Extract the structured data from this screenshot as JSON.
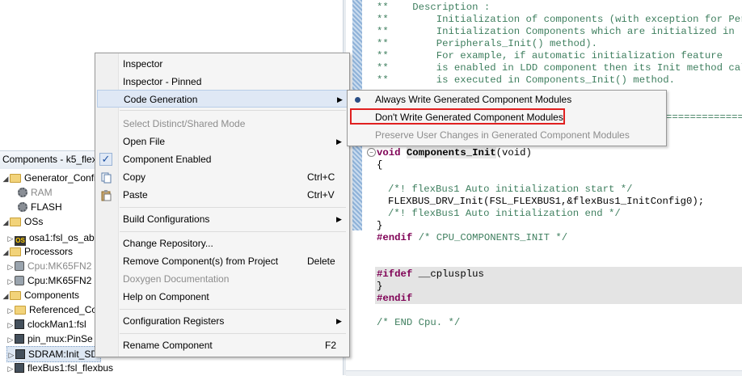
{
  "tree": {
    "header": "Components - k5_flex",
    "rows": [
      {
        "label": "Generator_Config",
        "icon": "folder-icon"
      },
      {
        "label": "RAM",
        "icon": "gear-icon"
      },
      {
        "label": "FLASH",
        "icon": "gear-icon"
      },
      {
        "label": "OSs",
        "icon": "folder-icon"
      },
      {
        "label": "osa1:fsl_os_ab",
        "icon": "os-component-icon"
      },
      {
        "label": "Processors",
        "icon": "folder-icon"
      },
      {
        "label": "Cpu:MK65FN2",
        "icon": "cpu-icon"
      },
      {
        "label": "Cpu:MK65FN2",
        "icon": "cpu-icon"
      },
      {
        "label": "Components",
        "icon": "folder-icon"
      },
      {
        "label": "Referenced_Co",
        "icon": "folder-icon"
      },
      {
        "label": "clockMan1:fsl",
        "icon": "component-icon"
      },
      {
        "label": "pin_mux:PinSe",
        "icon": "component-icon"
      },
      {
        "label": "SDRAM:Init_SD",
        "icon": "component-icon"
      },
      {
        "label": "flexBus1:fsl_flexbus",
        "icon": "component-icon"
      }
    ]
  },
  "editor": {
    "lines": {
      "l1": "**    Description :",
      "l2": "**        Initialization of components (with exception for Perip",
      "l3": "**        Initialization Components which are initialized in",
      "l4": "**        Peripherals_Init() method).",
      "l5": "**        For example, if automatic initialization feature",
      "l6": "**        is enabled in LDD component then its Init method call",
      "l7": "**        is executed in Components_Init() method.",
      "sepline": "=================",
      "func_kw": "void",
      "func_name": "Components_Init",
      "func_args": "(void)",
      "brace_open": "{",
      "c_start": "/*! flexBus1 Auto initialization start */",
      "call": "FLEXBUS_DRV_Init(FSL_FLEXBUS1,&flexBus1_InitConfig0);",
      "c_end": "/*! flexBus1 Auto initialization end */",
      "brace_close": "}",
      "endif1_kw": "#endif",
      "endif1_cmt": "/* CPU_COMPONENTS_INIT */",
      "ifdef_kw": "#ifdef",
      "ifdef_rest": " __cplusplus",
      "brace_close2": "}",
      "endif2_kw": "#endif",
      "end_cmt": "/* END Cpu. */"
    }
  },
  "context_menu": {
    "items": [
      {
        "label": "Inspector"
      },
      {
        "label": "Inspector - Pinned"
      },
      {
        "label": "Code Generation",
        "submenu": true,
        "highlighted": true
      },
      {
        "label": "Select Distinct/Shared Mode",
        "disabled": true
      },
      {
        "label": "Open File",
        "submenu": true
      },
      {
        "label": "Component Enabled",
        "checked": true
      },
      {
        "label": "Copy",
        "shortcut": "Ctrl+C"
      },
      {
        "label": "Paste",
        "shortcut": "Ctrl+V"
      },
      {
        "label": "Build Configurations",
        "submenu": true
      },
      {
        "label": "Change Repository..."
      },
      {
        "label": "Remove Component(s) from Project",
        "shortcut": "Delete"
      },
      {
        "label": "Doxygen Documentation",
        "disabled": true
      },
      {
        "label": "Help on Component"
      },
      {
        "label": "Configuration Registers",
        "submenu": true
      },
      {
        "label": "Rename Component",
        "shortcut": "F2"
      }
    ]
  },
  "submenu": {
    "items": [
      {
        "label": "Always Write Generated Component Modules",
        "selected": true
      },
      {
        "label": "Don't Write Generated Component Modules",
        "emphasized": true
      },
      {
        "label": "Preserve User Changes in Generated Component Modules",
        "disabled": true
      }
    ]
  },
  "colors": {
    "highlight_box": "#e02020",
    "comment": "#3f7f5f",
    "keyword": "#7f0055"
  }
}
